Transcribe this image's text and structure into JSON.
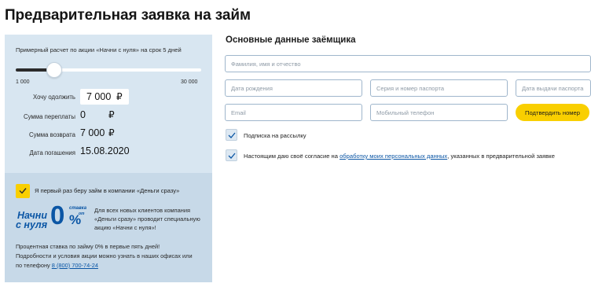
{
  "page": {
    "title": "Предварительная заявка на займ"
  },
  "calculator": {
    "caption": "Примерный расчет по акции «Начни с нуля» на срок 5 дней",
    "slider": {
      "min_label": "1 000",
      "max_label": "30 000",
      "min": 1000,
      "max": 30000,
      "value": 7000
    },
    "borrow_label": "Хочу одолжить",
    "borrow_value": "7 000",
    "overpay_label": "Сумма переплаты",
    "overpay_value": "0",
    "return_label": "Сумма возврата",
    "return_value": "7 000",
    "due_label": "Дата погашения",
    "due_value": "15.08.2020",
    "currency_symbol": "₽"
  },
  "promo": {
    "first_time_label": "Я первый раз беру займ в компании «Деньги сразу»",
    "first_time_checked": true,
    "logo": {
      "line1": "Начни",
      "line2": "с нуля",
      "zero": "0",
      "percent": "%",
      "small_a": "ставка",
      "small_b": "от"
    },
    "description": "Для всех новых клиентов компания «Деньги сразу» проводит специальную акцию «Начни с нуля»!",
    "footer_line1": "Процентная ставка по займу 0% в первые пять дней!",
    "footer_line2": "Подробности и условия акции можно узнать в наших офисах или",
    "footer_line3_prefix": "по телефону ",
    "phone": "8 (800) 700-74-24"
  },
  "form": {
    "title": "Основные данные заёмщика",
    "fields": {
      "fio_placeholder": "Фамилия, имя и отчество",
      "birth_placeholder": "Дата рождения",
      "passport_placeholder": "Серия и номер паспорта",
      "issue_placeholder": "Дата выдачи паспорта",
      "email_placeholder": "Email",
      "phone_placeholder": "Мобильный телефон"
    },
    "confirm_button": "Подтвердить номер",
    "subscribe_label": "Подписка на рассылку",
    "subscribe_checked": true,
    "agree_prefix": "Настоящим даю своё согласие на ",
    "agree_link": "обработку моих персональных данных",
    "agree_suffix": ", указанных в предварительной заявке",
    "agree_checked": true
  },
  "colors": {
    "accent_yellow": "#f9cf00",
    "brand_blue": "#0b56a5",
    "panel_light": "#d8e6f1",
    "panel_promo": "#c7d9e8",
    "field_border": "#9fb6cc"
  }
}
